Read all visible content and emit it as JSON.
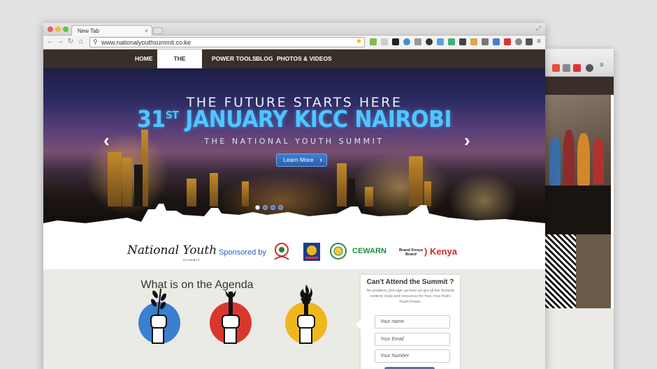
{
  "browser": {
    "tab_title": "New Tab",
    "tab_close": "×",
    "url": "www.nationalyouthsummit.co.ke"
  },
  "site_nav": {
    "items": [
      "HOME",
      "THE SUMMIT",
      "POWER TOOLS",
      "BLOG",
      "PHOTOS & VIDEOS"
    ],
    "active": "THE SUMMIT"
  },
  "hero": {
    "line1": "THE FUTURE STARTS HERE",
    "line2_day": "31",
    "line2_sup": "ST",
    "line2_rest": " JANUARY KICC NAIROBI",
    "line3": "THE NATIONAL YOUTH SUMMIT",
    "button_label": "Learn More",
    "button_chevron": "›",
    "prev_arrow": "‹",
    "next_arrow": "›",
    "slide_count": 4,
    "active_slide": 1
  },
  "sponsors": {
    "logo_text_1": "National",
    "logo_text_2": "Youth",
    "logo_sub": "SUMMIT",
    "sponsored_by": "Sponsored by",
    "cewarn": "CEWARN",
    "brand_kenya_line1": "Brand Kenya",
    "brand_kenya_line2": "Board",
    "kenya": ") Kenya"
  },
  "agenda": {
    "title": "What is on the Agenda"
  },
  "signup": {
    "title": "Can't Attend the Summit ?",
    "text": "No problem, just sign up here an get all the Summit content, tools and resources for free, now that's Youth Power.",
    "name_placeholder": "Your name",
    "email_placeholder": "Your Email",
    "number_placeholder": "Your Number"
  },
  "colors": {
    "nav_bg": "#3a2e28",
    "accent_blue": "#2b62b5",
    "hero_title": "#4fc6ff",
    "agenda_blue": "#3b7fcf",
    "agenda_red": "#d9372e",
    "agenda_yellow": "#f0b71c"
  }
}
